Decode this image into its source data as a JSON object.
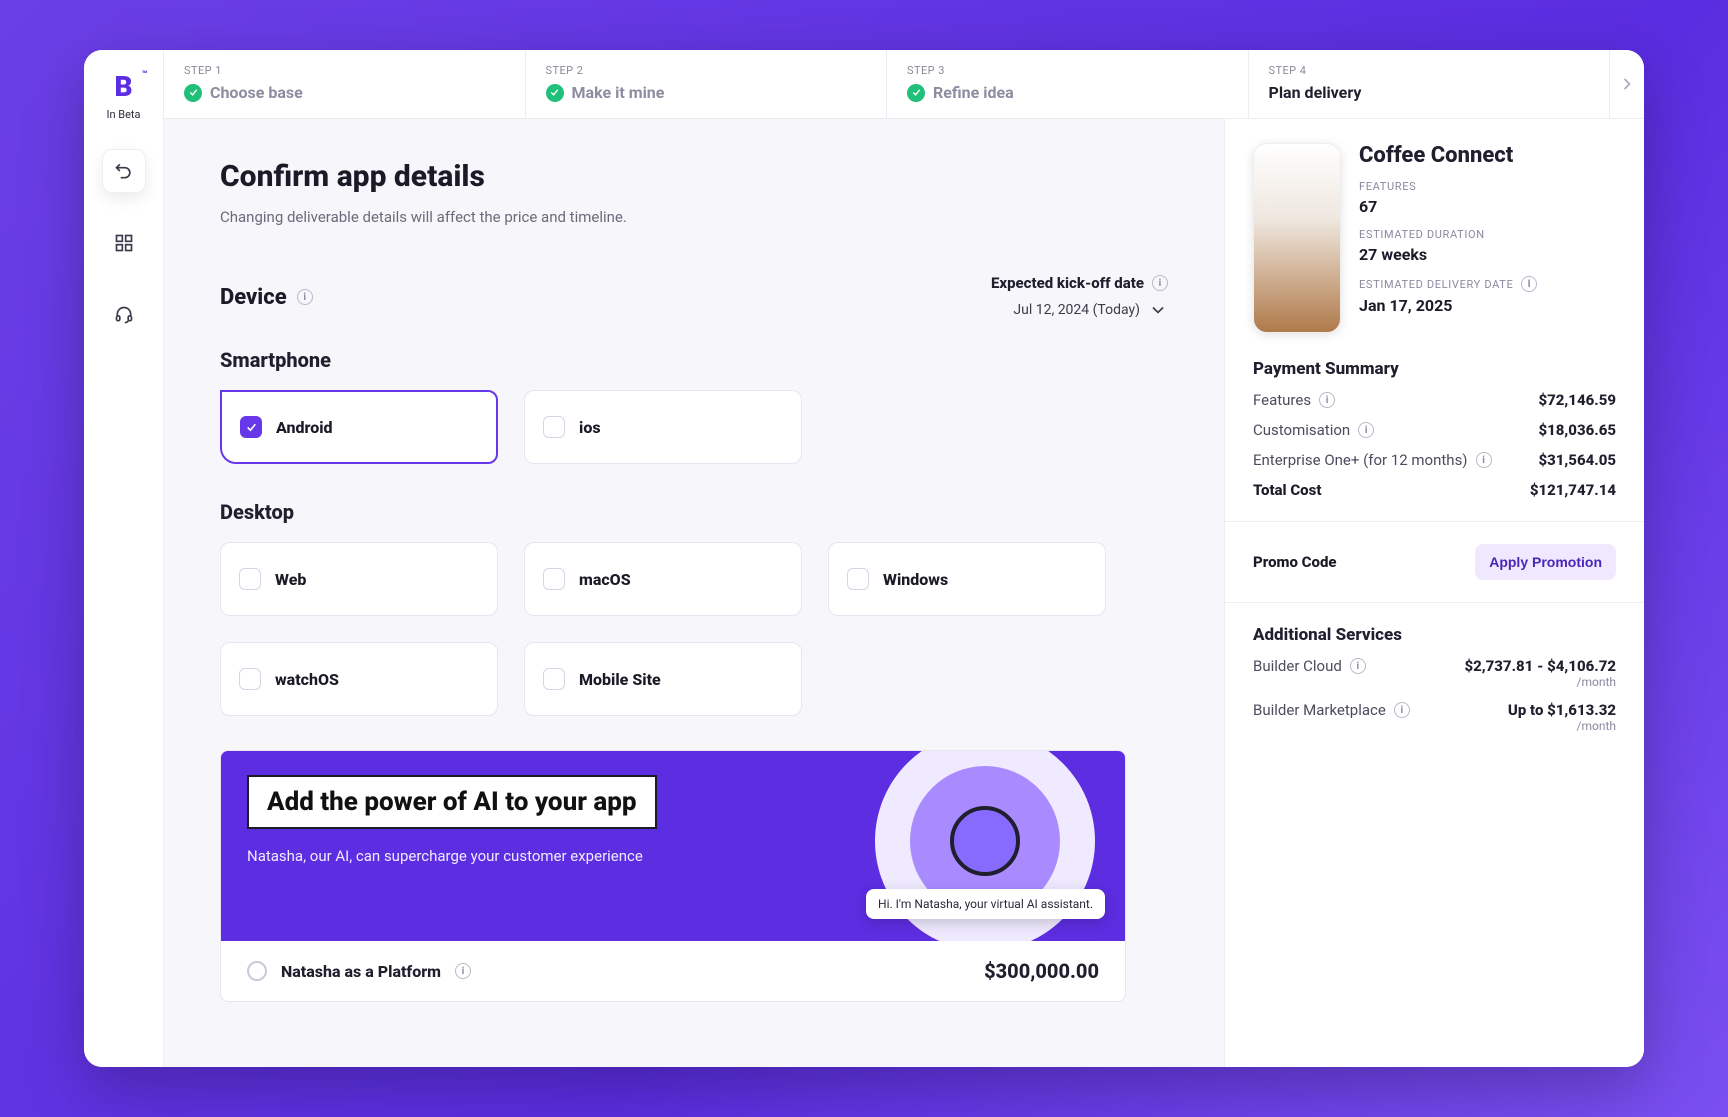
{
  "brand": {
    "letter": "B",
    "tm": "™",
    "sub": "In Beta"
  },
  "steps": [
    {
      "label": "STEP 1",
      "title": "Choose base",
      "done": true
    },
    {
      "label": "STEP 2",
      "title": "Make it mine",
      "done": true
    },
    {
      "label": "STEP 3",
      "title": "Refine idea",
      "done": true
    },
    {
      "label": "STEP 4",
      "title": "Plan delivery",
      "active": true
    }
  ],
  "page": {
    "title": "Confirm app details",
    "subtitle": "Changing deliverable details will affect the price and timeline."
  },
  "device_section": {
    "title": "Device",
    "kickoff_label": "Expected kick-off date",
    "kickoff_value": "Jul 12, 2024 (Today)",
    "smartphone_heading": "Smartphone",
    "desktop_heading": "Desktop",
    "smartphone": [
      {
        "name": "Android",
        "checked": true
      },
      {
        "name": "ios",
        "checked": false
      }
    ],
    "desktop": [
      {
        "name": "Web",
        "checked": false
      },
      {
        "name": "macOS",
        "checked": false
      },
      {
        "name": "Windows",
        "checked": false
      },
      {
        "name": "watchOS",
        "checked": false
      },
      {
        "name": "Mobile Site",
        "checked": false
      }
    ]
  },
  "ai": {
    "title": "Add the power of AI to your app",
    "subtitle": "Natasha, our AI, can supercharge your customer experience",
    "bubble": "Hi. I'm Natasha, your virtual AI assistant.",
    "option_label": "Natasha as a Platform",
    "option_price": "$300,000.00"
  },
  "summary": {
    "project_name": "Coffee Connect",
    "features_label": "FEATURES",
    "features_value": "67",
    "duration_label": "ESTIMATED DURATION",
    "duration_value": "27 weeks",
    "delivery_label": "ESTIMATED DELIVERY DATE",
    "delivery_value": "Jan 17, 2025",
    "payment_title": "Payment Summary",
    "lines": [
      {
        "l": "Features",
        "r": "$72,146.59",
        "info": true
      },
      {
        "l": "Customisation",
        "r": "$18,036.65",
        "info": true
      },
      {
        "l": "Enterprise One+ (for 12 months)",
        "r": "$31,564.05",
        "info": true
      }
    ],
    "total_label": "Total Cost",
    "total_value": "$121,747.14",
    "promo_label": "Promo Code",
    "apply_label": "Apply Promotion",
    "services_title": "Additional Services",
    "services": [
      {
        "l": "Builder Cloud",
        "r": "$2,737.81 - $4,106.72",
        "per": "/month"
      },
      {
        "l": "Builder Marketplace",
        "r": "Up to $1,613.32",
        "per": "/month"
      }
    ]
  }
}
